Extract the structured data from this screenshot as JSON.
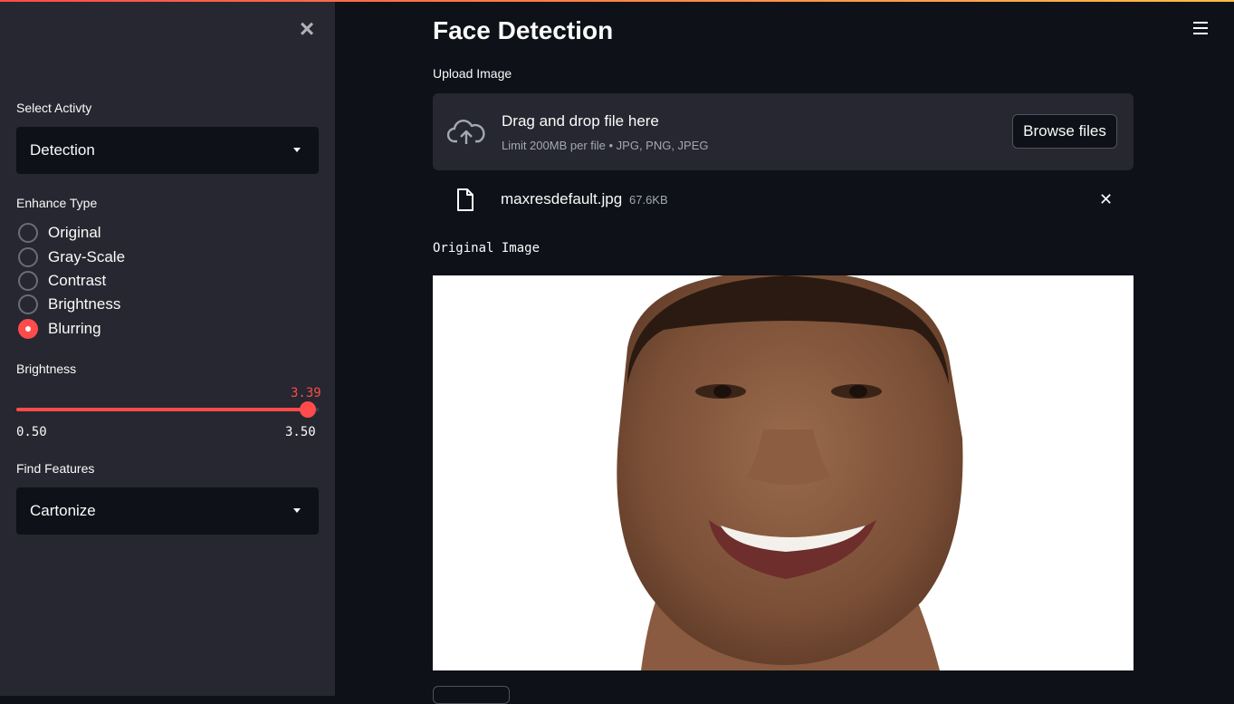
{
  "sidebar": {
    "select_activity_label": "Select Activty",
    "select_activity_value": "Detection",
    "enhance_type_label": "Enhance Type",
    "enhance_options": [
      {
        "label": "Original",
        "selected": false
      },
      {
        "label": "Gray-Scale",
        "selected": false
      },
      {
        "label": "Contrast",
        "selected": false
      },
      {
        "label": "Brightness",
        "selected": false
      },
      {
        "label": "Blurring",
        "selected": true
      }
    ],
    "slider": {
      "label": "Brightness",
      "value": "3.39",
      "min": "0.50",
      "max": "3.50"
    },
    "find_features_label": "Find Features",
    "find_features_value": "Cartonize"
  },
  "main": {
    "title": "Face Detection",
    "upload_label": "Upload Image",
    "dropzone_title": "Drag and drop file here",
    "dropzone_subtitle": "Limit 200MB per file • JPG, PNG, JPEG",
    "browse_label": "Browse files",
    "file_name": "maxresdefault.jpg",
    "file_size": "67.6KB",
    "original_image_label": "Original Image"
  },
  "colors": {
    "accent": "#ff4b4b",
    "sidebar_bg": "#262730",
    "main_bg": "#0e1117"
  }
}
